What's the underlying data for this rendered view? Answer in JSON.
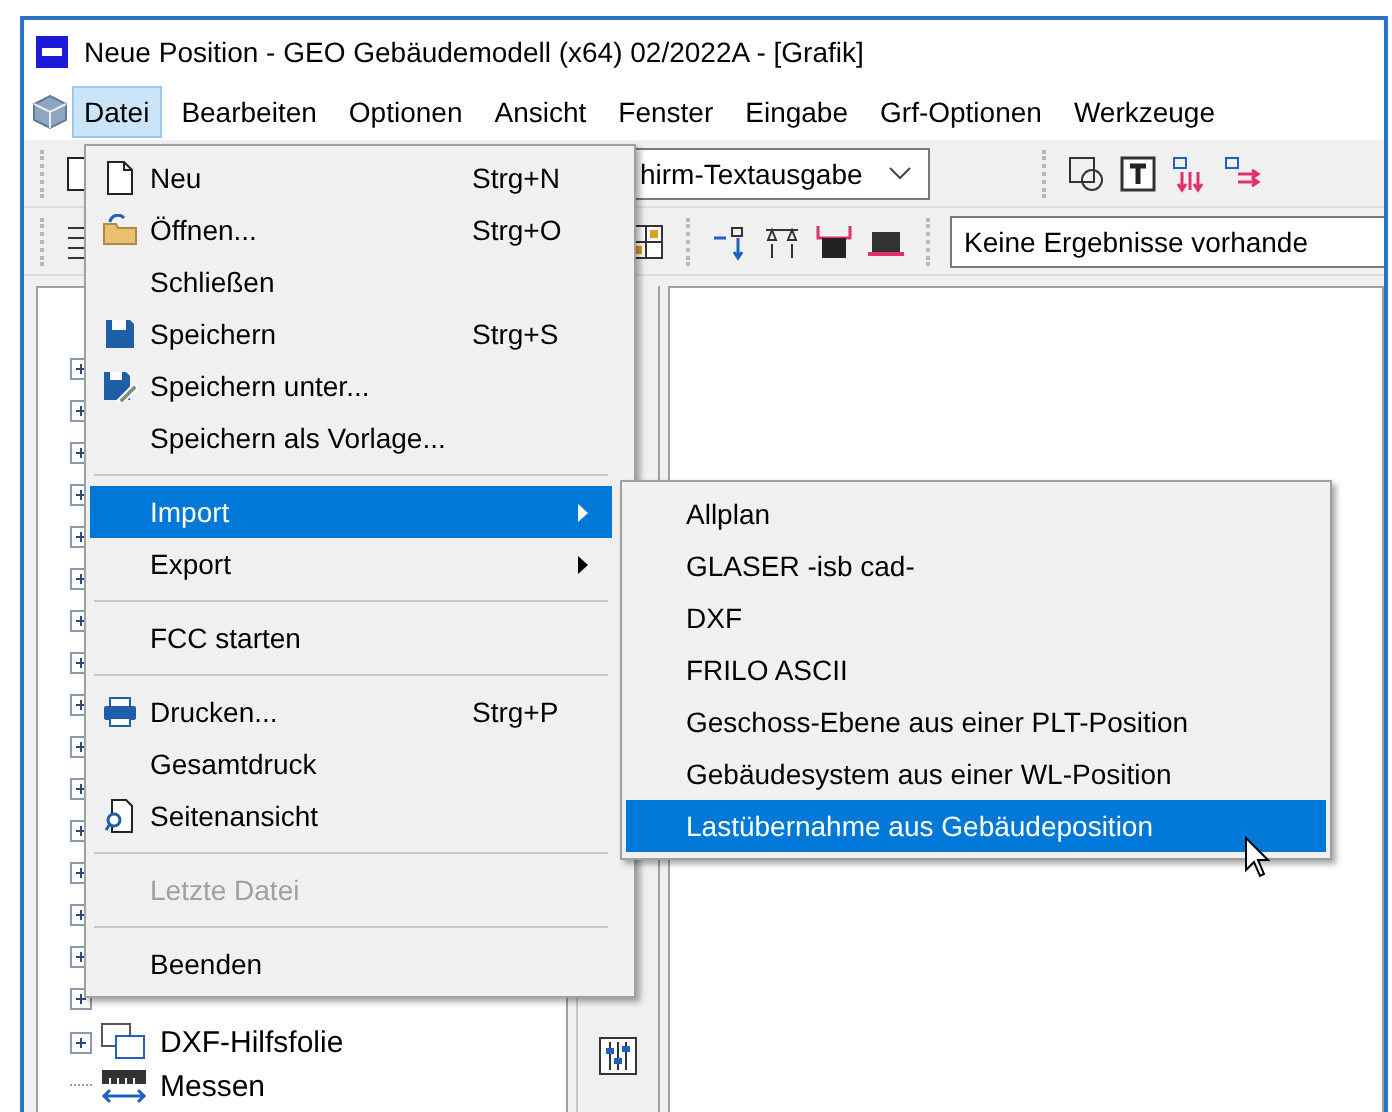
{
  "window": {
    "title": "Neue Position - GEO Gebäudemodell (x64) 02/2022A - [Grafik]"
  },
  "menubar": [
    {
      "label": "Datei",
      "selected": true
    },
    {
      "label": "Bearbeiten",
      "selected": false
    },
    {
      "label": "Optionen",
      "selected": false
    },
    {
      "label": "Ansicht",
      "selected": false
    },
    {
      "label": "Fenster",
      "selected": false
    },
    {
      "label": "Eingabe",
      "selected": false
    },
    {
      "label": "Grf-Optionen",
      "selected": false
    },
    {
      "label": "Werkzeuge",
      "selected": false
    }
  ],
  "toolbar": {
    "view_combo": "hirm-Textausgabe",
    "results_field": "Keine Ergebnisse vorhande"
  },
  "tree": [
    {
      "label": "DXF-Hilfsfolie",
      "expandable": true
    },
    {
      "label": "Messen",
      "expandable": false
    }
  ],
  "file_menu": [
    {
      "kind": "item",
      "label": "Neu",
      "shortcut": "Strg+N",
      "selected": false,
      "disabled": false
    },
    {
      "kind": "item",
      "label": "Öffnen...",
      "shortcut": "Strg+O",
      "selected": false,
      "disabled": false
    },
    {
      "kind": "item",
      "label": "Schließen",
      "selected": false,
      "disabled": false
    },
    {
      "kind": "item",
      "label": "Speichern",
      "shortcut": "Strg+S",
      "selected": false,
      "disabled": false
    },
    {
      "kind": "item",
      "label": "Speichern unter...",
      "selected": false,
      "disabled": false
    },
    {
      "kind": "item",
      "label": "Speichern als Vorlage...",
      "selected": false,
      "disabled": false
    },
    {
      "kind": "separator"
    },
    {
      "kind": "submenu",
      "label": "Import",
      "selected": true,
      "disabled": false
    },
    {
      "kind": "submenu",
      "label": "Export",
      "selected": false,
      "disabled": false
    },
    {
      "kind": "separator"
    },
    {
      "kind": "item",
      "label": "FCC starten",
      "selected": false,
      "disabled": false
    },
    {
      "kind": "separator"
    },
    {
      "kind": "item",
      "label": "Drucken...",
      "shortcut": "Strg+P",
      "selected": false,
      "disabled": false
    },
    {
      "kind": "item",
      "label": "Gesamtdruck",
      "selected": false,
      "disabled": false
    },
    {
      "kind": "item",
      "label": "Seitenansicht",
      "selected": false,
      "disabled": false
    },
    {
      "kind": "separator"
    },
    {
      "kind": "item",
      "label": "Letzte Datei",
      "selected": false,
      "disabled": true
    },
    {
      "kind": "separator"
    },
    {
      "kind": "item",
      "label": "Beenden",
      "selected": false,
      "disabled": false
    }
  ],
  "import_submenu": [
    {
      "label": "Allplan",
      "selected": false
    },
    {
      "label": "GLASER -isb cad-",
      "selected": false
    },
    {
      "label": "DXF",
      "selected": false
    },
    {
      "label": "FRILO ASCII",
      "selected": false
    },
    {
      "label": "Geschoss-Ebene aus einer PLT-Position",
      "selected": false
    },
    {
      "label": "Gebäudesystem  aus einer WL-Position",
      "selected": false
    },
    {
      "label": "Lastübernahme aus Gebäudeposition",
      "selected": true
    }
  ]
}
